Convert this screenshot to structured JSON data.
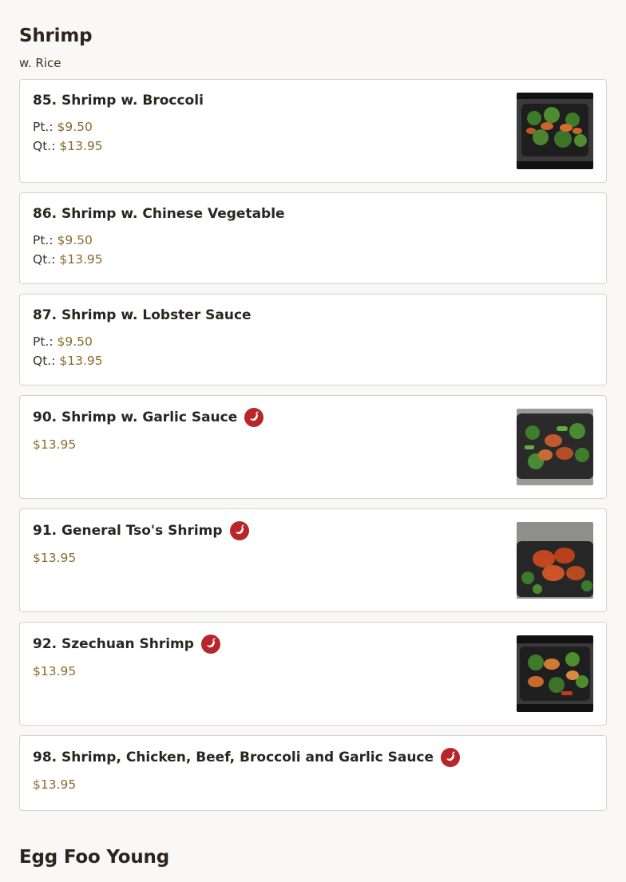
{
  "section": {
    "title": "Shrimp",
    "subtitle": "w. Rice"
  },
  "items": [
    {
      "name": "85. Shrimp w. Broccoli",
      "pt_label": "Pt.:",
      "pt_price": "$9.50",
      "qt_label": "Qt.:",
      "qt_price": "$13.95",
      "spicy": false,
      "photo": "broccoli-dish"
    },
    {
      "name": "86. Shrimp w. Chinese Vegetable",
      "pt_label": "Pt.:",
      "pt_price": "$9.50",
      "qt_label": "Qt.:",
      "qt_price": "$13.95",
      "spicy": false
    },
    {
      "name": "87. Shrimp w. Lobster Sauce",
      "pt_label": "Pt.:",
      "pt_price": "$9.50",
      "qt_label": "Qt.:",
      "qt_price": "$13.95",
      "spicy": false
    },
    {
      "name": "90. Shrimp w. Garlic Sauce",
      "price": "$13.95",
      "spicy": true,
      "photo": "garlic-dish"
    },
    {
      "name": "91. General Tso's Shrimp",
      "price": "$13.95",
      "spicy": true,
      "photo": "general-tso-dish"
    },
    {
      "name": "92. Szechuan Shrimp",
      "price": "$13.95",
      "spicy": true,
      "photo": "szechuan-dish"
    },
    {
      "name": "98. Shrimp, Chicken, Beef, Broccoli and Garlic Sauce",
      "price": "$13.95",
      "spicy": true
    }
  ],
  "next_section": {
    "title": "Egg Foo Young"
  },
  "icons": {
    "spicy": "hot-pepper-icon"
  },
  "colors": {
    "price": "#8a6a2c",
    "spicy_badge": "#b8262a",
    "background": "#faf8f6",
    "card_border": "#d6d2cd"
  }
}
